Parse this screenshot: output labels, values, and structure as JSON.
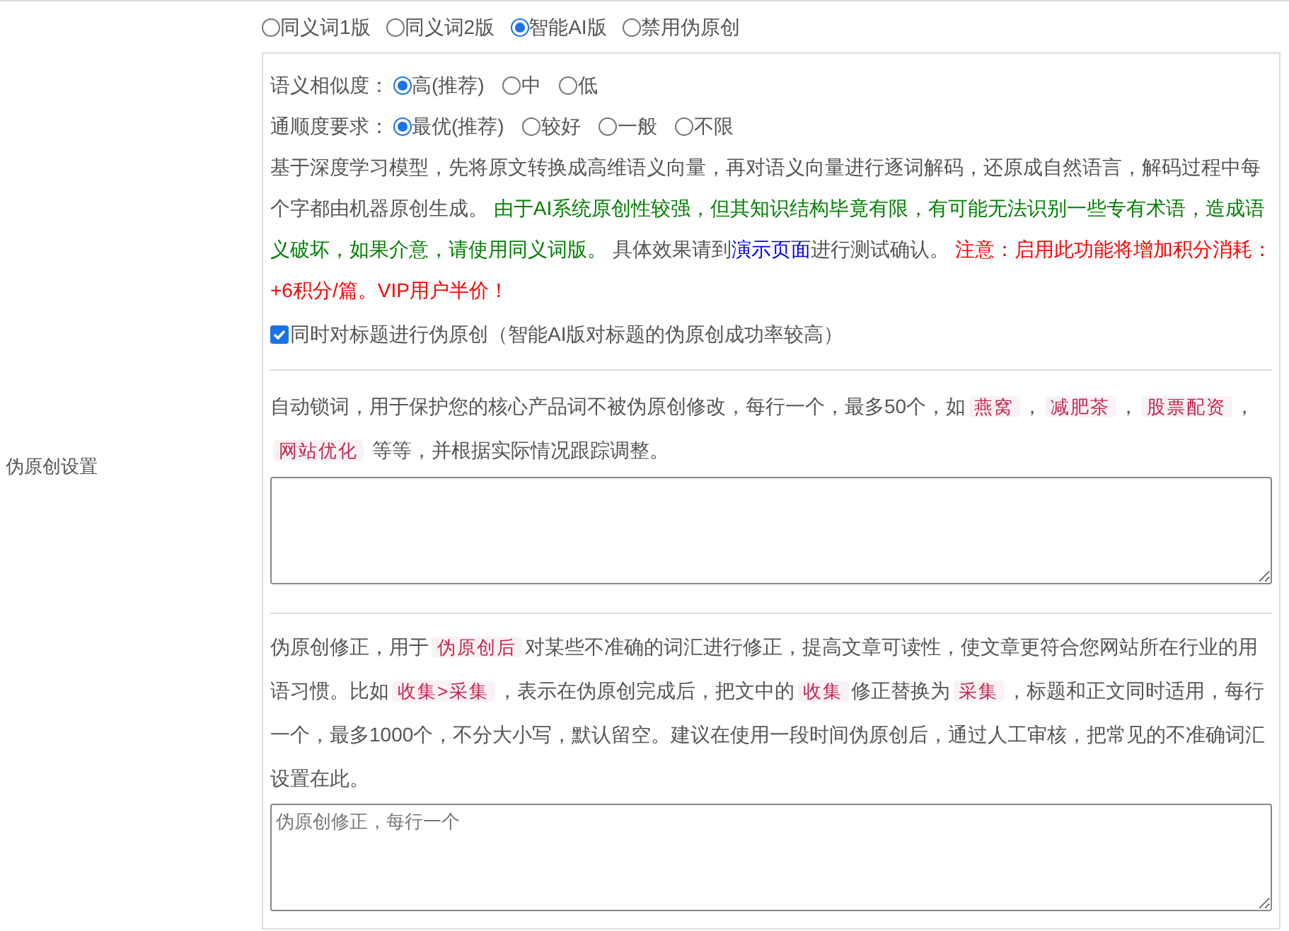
{
  "side_label": "伪原创设置",
  "mode_options": [
    {
      "label": "同义词1版",
      "selected": false
    },
    {
      "label": "同义词2版",
      "selected": false
    },
    {
      "label": "智能AI版",
      "selected": true
    },
    {
      "label": "禁用伪原创",
      "selected": false
    }
  ],
  "similarity": {
    "label": "语义相似度：",
    "options": [
      {
        "label": "高(推荐)",
        "selected": true
      },
      {
        "label": "中",
        "selected": false
      },
      {
        "label": "低",
        "selected": false
      }
    ]
  },
  "fluency": {
    "label": "通顺度要求：",
    "options": [
      {
        "label": "最优(推荐)",
        "selected": true
      },
      {
        "label": "较好",
        "selected": false
      },
      {
        "label": "一般",
        "selected": false
      },
      {
        "label": "不限",
        "selected": false
      }
    ]
  },
  "description": [
    {
      "kind": "plain",
      "text": "基于深度学习模型，先将原文转换成高维语义向量，再对语义向量进行逐词解码，还原成自然语言，解码过程中每个字都由机器原创生成。 "
    },
    {
      "kind": "note",
      "text": "由于AI系统原创性较强，但其知识结构毕竟有限，有可能无法识别一些专有术语，造成语义破坏，如果介意，请使用同义词版。"
    },
    {
      "kind": "plain",
      "text": " 具体效果请到"
    },
    {
      "kind": "link",
      "text": "演示页面"
    },
    {
      "kind": "plain",
      "text": "进行测试确认。 "
    },
    {
      "kind": "warning",
      "text": "注意：启用此功能将增加积分消耗：+6积分/篇。VIP用户半价！"
    }
  ],
  "title_checkbox": {
    "label": "同时对标题进行伪原创（智能AI版对标题的伪原创成功率较高）",
    "checked": true
  },
  "lock_words": {
    "text": [
      {
        "kind": "plain",
        "text": "自动锁词，用于保护您的核心产品词不被伪原创修改，每行一个，最多50个，如"
      },
      {
        "kind": "tag",
        "text": "燕窝"
      },
      {
        "kind": "plain",
        "text": "，"
      },
      {
        "kind": "tag",
        "text": "减肥茶"
      },
      {
        "kind": "plain",
        "text": "，"
      },
      {
        "kind": "tag",
        "text": "股票配资"
      },
      {
        "kind": "plain",
        "text": "，"
      },
      {
        "kind": "tag",
        "text": "网站优化"
      },
      {
        "kind": "plain",
        "text": " 等等，并根据实际情况跟踪调整。"
      }
    ]
  },
  "correction": {
    "text": [
      {
        "kind": "plain",
        "text": "伪原创修正，用于"
      },
      {
        "kind": "tag",
        "text": "伪原创后"
      },
      {
        "kind": "plain",
        "text": "对某些不准确的词汇进行修正，提高文章可读性，使文章更符合您网站所在行业的用语习惯。比如"
      },
      {
        "kind": "tag",
        "text": "收集>采集"
      },
      {
        "kind": "plain",
        "text": "，表示在伪原创完成后，把文中的"
      },
      {
        "kind": "tag",
        "text": "收集"
      },
      {
        "kind": "plain",
        "text": "修正替换为"
      },
      {
        "kind": "tag",
        "text": "采集"
      },
      {
        "kind": "plain",
        "text": "，标题和正文同时适用，每行一个，最多1000个，不分大小写，默认留空。建议在使用一段时间伪原创后，通过人工审核，把常见的不准确词汇设置在此。"
      }
    ],
    "placeholder": "伪原创修正，每行一个"
  }
}
